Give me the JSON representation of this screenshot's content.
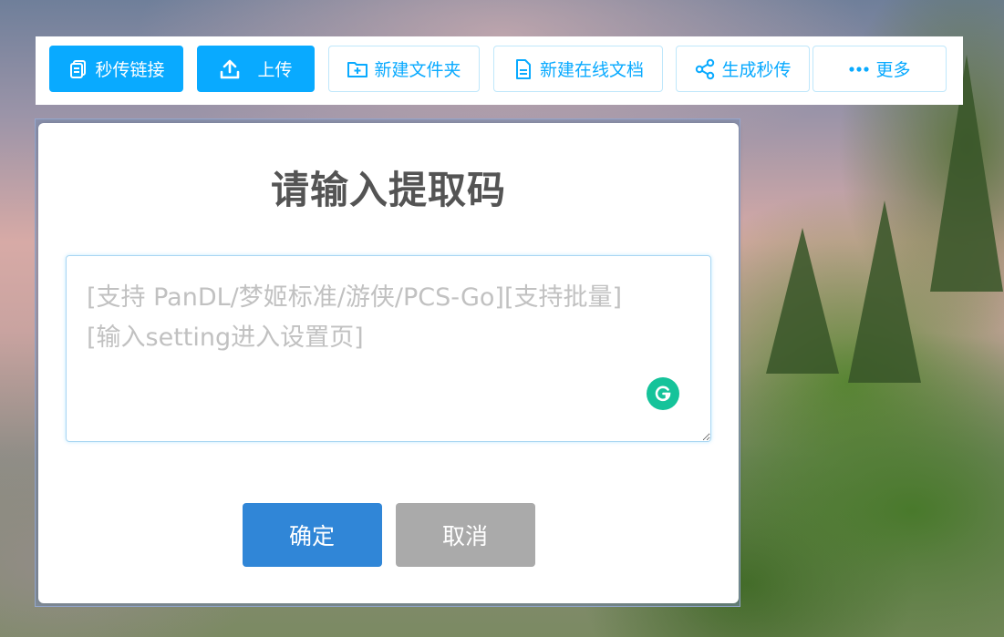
{
  "toolbar": {
    "buttons": [
      {
        "label": "秒传链接",
        "icon": "copy-link-icon",
        "style": "primary"
      },
      {
        "label": "上传",
        "icon": "upload-icon",
        "style": "primary"
      },
      {
        "label": "新建文件夹",
        "icon": "new-folder-icon",
        "style": "secondary"
      },
      {
        "label": "新建在线文档",
        "icon": "document-icon",
        "style": "secondary"
      },
      {
        "label": "生成秒传",
        "icon": "share-icon",
        "style": "secondary"
      },
      {
        "label": "更多",
        "icon": "more-dots-icon",
        "style": "secondary"
      }
    ]
  },
  "dialog": {
    "title": "请输入提取码",
    "input": {
      "value": "",
      "placeholder": "[支持 PanDL/梦姬标准/游侠/PCS-Go][支持批量]\n[输入setting进入设置页]"
    },
    "confirm_label": "确定",
    "cancel_label": "取消"
  },
  "colors": {
    "primary": "#09aaff",
    "confirm": "#3086d7",
    "cancel": "#aaaaaa",
    "grammarly": "#15c39a"
  }
}
